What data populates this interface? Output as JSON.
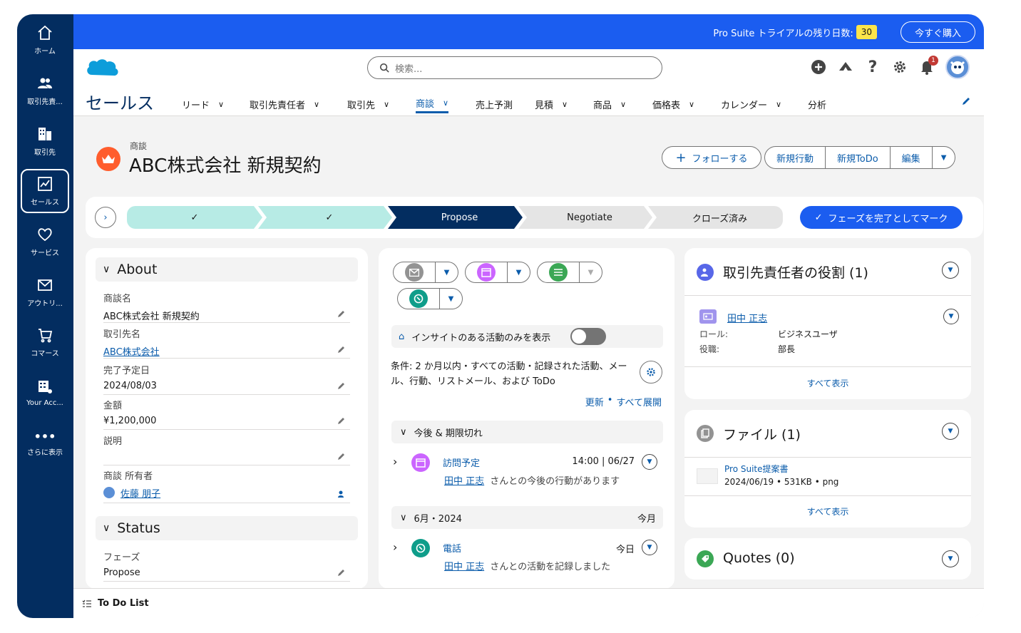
{
  "sidebar": {
    "items": [
      {
        "label": "ホーム",
        "icon": "home-icon"
      },
      {
        "label": "取引先責...",
        "icon": "contacts-icon"
      },
      {
        "label": "取引先",
        "icon": "building-icon"
      },
      {
        "label": "セールス",
        "icon": "sales-chart-icon"
      },
      {
        "label": "サービス",
        "icon": "heart-icon"
      },
      {
        "label": "アウトリ...",
        "icon": "envelope-icon"
      },
      {
        "label": "コマース",
        "icon": "cart-icon"
      },
      {
        "label": "Your Acc...",
        "icon": "account-icon"
      },
      {
        "label": "さらに表示",
        "icon": "more-icon"
      }
    ]
  },
  "banner": {
    "trial_text": "Pro Suite トライアルの残り日数:",
    "days": "30",
    "buy_label": "今すぐ購入"
  },
  "topbar": {
    "search_placeholder": "検索...",
    "notification_count": "1"
  },
  "nav": {
    "app_name": "セールス",
    "items": [
      {
        "label": "リード",
        "dropdown": true
      },
      {
        "label": "取引先責任者",
        "dropdown": true
      },
      {
        "label": "取引先",
        "dropdown": true
      },
      {
        "label": "商談",
        "dropdown": true,
        "active": true
      },
      {
        "label": "売上予測",
        "dropdown": false
      },
      {
        "label": "見積",
        "dropdown": true
      },
      {
        "label": "商品",
        "dropdown": true
      },
      {
        "label": "価格表",
        "dropdown": true
      },
      {
        "label": "カレンダー",
        "dropdown": true
      },
      {
        "label": "分析",
        "dropdown": false
      }
    ]
  },
  "record": {
    "type": "商談",
    "title": "ABC株式会社 新規契約",
    "follow_label": "フォローする",
    "actions": [
      "新規行動",
      "新規ToDo",
      "編集"
    ]
  },
  "path": {
    "stages": [
      {
        "label": "✓",
        "state": "complete"
      },
      {
        "label": "✓",
        "state": "complete"
      },
      {
        "label": "Propose",
        "state": "current"
      },
      {
        "label": "Negotiate",
        "state": "incomplete"
      },
      {
        "label": "クローズ済み",
        "state": "incomplete"
      }
    ],
    "mark_label": "フェーズを完了としてマーク"
  },
  "about": {
    "heading": "About",
    "fields": [
      {
        "label": "商談名",
        "value": "ABC株式会社 新規契約",
        "link": false
      },
      {
        "label": "取引先名",
        "value": "ABC株式会社",
        "link": true
      },
      {
        "label": "完了予定日",
        "value": "2024/08/03",
        "link": false
      },
      {
        "label": "金額",
        "value": "¥1,200,000",
        "link": false
      },
      {
        "label": "説明",
        "value": "",
        "link": false
      },
      {
        "label": "商談 所有者",
        "value": "佐藤 朋子",
        "link": true
      }
    ]
  },
  "status": {
    "heading": "Status",
    "fields": [
      {
        "label": "フェーズ",
        "value": "Propose"
      }
    ]
  },
  "activity": {
    "insight_label": "インサイトのある活動のみを表示",
    "filter_text": "条件: 2 か月以内・すべての活動・記録された活動、メール、行動、リストメール、および ToDo",
    "refresh": "更新",
    "expand_all": "すべて展開",
    "sep": "•",
    "upcoming_heading": "今後 & 期限切れ",
    "upcoming_item": {
      "title": "訪問予定",
      "time": "14:00 | 06/27",
      "person": "田中 正志",
      "desc": "さんとの今後の行動があります"
    },
    "month_heading": "6月・2024",
    "month_tag": "今月",
    "month_item": {
      "title": "電話",
      "time": "今日",
      "person": "田中 正志",
      "desc": "さんとの活動を記録しました"
    }
  },
  "contact_roles": {
    "heading": "取引先責任者の役割 (1)",
    "name": "田中 正志",
    "role_label": "ロール:",
    "role_value": "ビジネスユーザ",
    "title_label": "役職:",
    "title_value": "部長",
    "view_all": "すべて表示"
  },
  "files": {
    "heading": "ファイル (1)",
    "file_name": "Pro Suite提案書",
    "file_meta": "2024/06/19 • 531KB • png",
    "view_all": "すべて表示"
  },
  "quotes": {
    "heading": "Quotes (0)"
  },
  "todo_bar": {
    "label": "To Do List"
  }
}
